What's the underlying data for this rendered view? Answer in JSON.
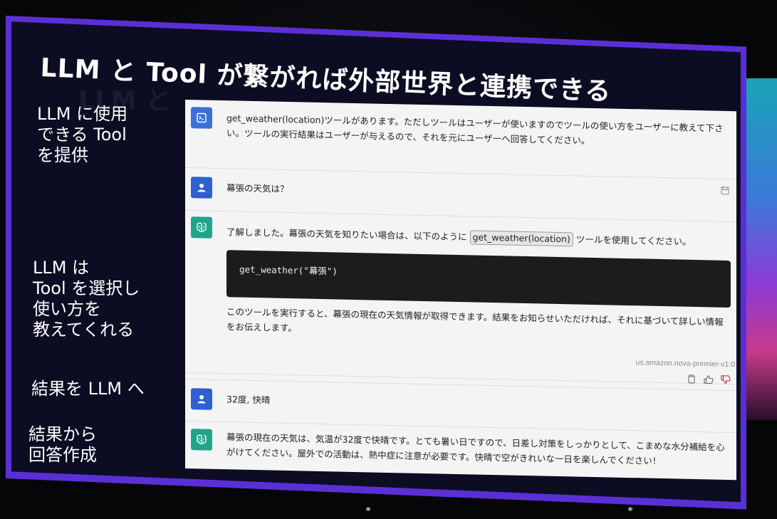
{
  "slide": {
    "title": "LLM と Tool が繋がれば外部世界と連携できる",
    "ghost_title": "LLM と",
    "captions": [
      [
        "LLM に使用",
        "できる Tool",
        "を提供"
      ],
      [
        "LLM は",
        "Tool を選択し",
        "使い方を",
        "教えてくれる"
      ],
      [
        "結果を LLM へ"
      ],
      [
        "結果から",
        "回答作成"
      ]
    ]
  },
  "chat": {
    "system_message": "get_weather(location)ツールがあります。ただしツールはユーザーが使いますのでツールの使い方をユーザーに教えて下さい。ツールの実行結果はユーザーが与えるので、それを元にユーザーへ回答してください。",
    "user_message_1": "幕張の天気は？",
    "ai_message_1_pre": "了解しました。幕張の天気を知りたい場合は、以下のように",
    "ai_message_1_tool": "get_weather(location)",
    "ai_message_1_post": "ツールを使用してください。",
    "code_block": "get_weather(\"幕張\")",
    "ai_message_1_followup": "このツールを実行すると、幕張の現在の天気情報が取得できます。結果をお知らせいただければ、それに基づいて詳しい情報をお伝えします。",
    "model_id": "us.amazon.nova-premier-v1:0",
    "user_message_2": "32度, 快晴",
    "ai_message_2": "幕張の現在の天気は、気温が32度で快晴です。とても暑い日ですので、日差し対策をしっかりとして、こまめな水分補給を心がけてください。屋外での活動は、熱中症に注意が必要です。快晴で空がきれいな一日を楽しんでください！"
  },
  "colors": {
    "frame": "#5b2fd6",
    "system_avatar": "#3c6fd8",
    "user_avatar": "#2f5fd0",
    "ai_avatar": "#1fa58a",
    "code_bg": "#1c1c1e"
  },
  "icons": {
    "system": "system-prompt-icon",
    "user": "user-icon",
    "ai": "ai-brain-icon",
    "save": "save-icon",
    "copy": "copy-icon",
    "like": "thumbs-up-icon",
    "dislike": "thumbs-down-icon"
  }
}
